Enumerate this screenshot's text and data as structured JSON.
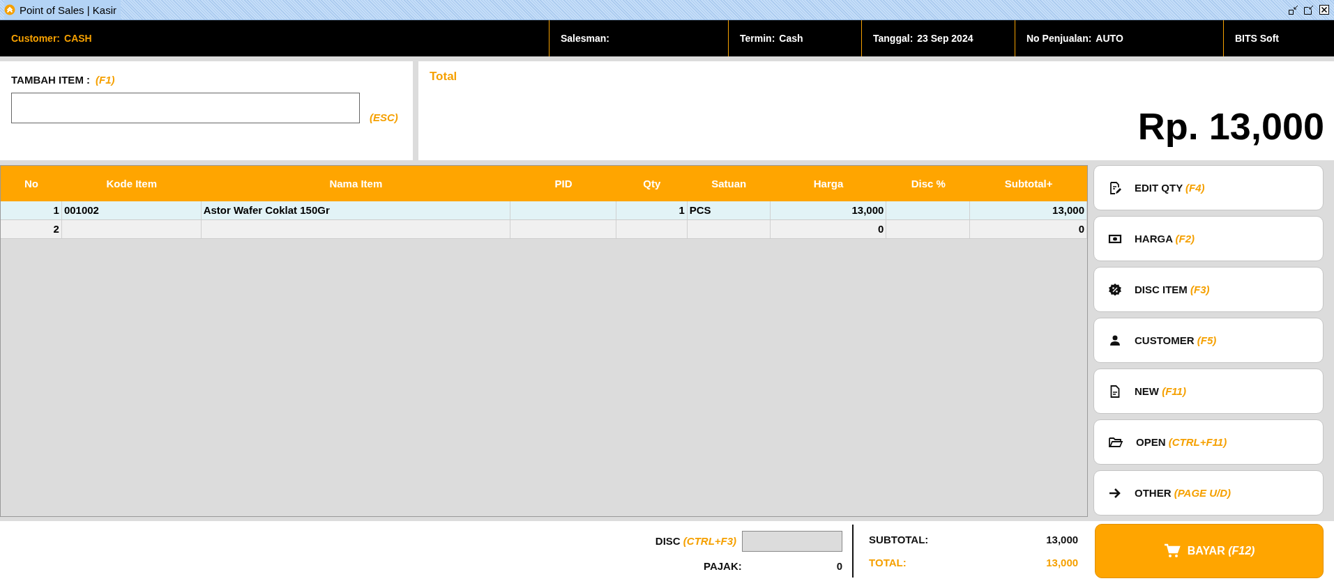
{
  "window": {
    "title": "Point of Sales | Kasir"
  },
  "header": [
    {
      "kind": "highlight",
      "label": "Customer:",
      "value": "CASH"
    },
    {
      "kind": "plain",
      "label": "Salesman:"
    },
    {
      "kind": "plain",
      "label": "Termin:",
      "value": "Cash"
    },
    {
      "kind": "plain",
      "label": "Tanggal:",
      "value": "23 Sep 2024"
    },
    {
      "kind": "plain",
      "label": "No Penjualan:",
      "value": "AUTO"
    },
    {
      "kind": "brand",
      "label": "BITS Soft"
    }
  ],
  "add_item": {
    "label": "TAMBAH ITEM :",
    "shortcut": "(F1)",
    "clear_shortcut": "(ESC)"
  },
  "total_panel": {
    "label": "Total",
    "amount": "Rp. 13,000"
  },
  "table": {
    "columns": [
      "No",
      "Kode Item",
      "Nama Item",
      "PID",
      "Qty",
      "Satuan",
      "Harga",
      "Disc %",
      "Subtotal+"
    ],
    "rows": [
      {
        "selected": true,
        "cells": [
          "1",
          "001002",
          "Astor Wafer Coklat 150Gr",
          "",
          "1",
          "PCS",
          "13,000",
          "",
          "13,000"
        ]
      },
      {
        "selected": false,
        "cells": [
          "2",
          "",
          "",
          "",
          "",
          "",
          "0",
          "",
          "0"
        ]
      }
    ]
  },
  "actions": [
    {
      "kind": "edit",
      "label": "EDIT QTY",
      "shortcut": "(F4)"
    },
    {
      "kind": "money",
      "label": "HARGA",
      "shortcut": "(F2)"
    },
    {
      "kind": "discount",
      "label": "DISC ITEM",
      "shortcut": "(F3)"
    },
    {
      "kind": "person",
      "label": "CUSTOMER",
      "shortcut": "(F5)"
    },
    {
      "kind": "file",
      "label": "NEW",
      "shortcut": "(F11)"
    },
    {
      "kind": "folder",
      "label": "OPEN",
      "shortcut": "(CTRL+F11)"
    },
    {
      "kind": "arrow",
      "label": "OTHER",
      "shortcut": "(PAGE U/D)"
    }
  ],
  "pay_button": {
    "label": "BAYAR",
    "shortcut": "(F12)"
  },
  "summary": {
    "disc_label": "DISC",
    "disc_shortcut": "(CTRL+F3)",
    "tax_label": "PAJAK:",
    "tax_value": "0",
    "subtotal_label": "SUBTOTAL:",
    "subtotal_value": "13,000",
    "total_label": "TOTAL:",
    "total_value": "13,000"
  }
}
